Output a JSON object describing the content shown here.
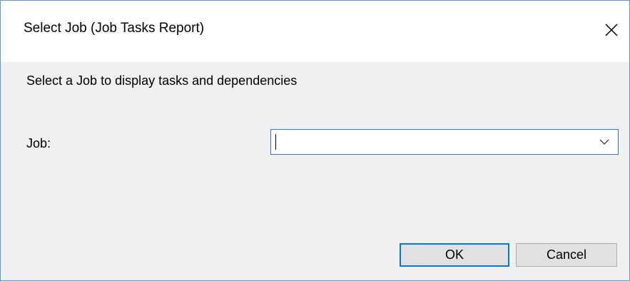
{
  "dialog": {
    "title": "Select Job (Job Tasks Report)",
    "close_icon": "close-icon",
    "instruction": "Select a Job to display tasks and dependencies",
    "job_label": "Job:",
    "job_value": "",
    "dropdown_icon": "chevron-down-icon",
    "ok_label": "OK",
    "cancel_label": "Cancel"
  },
  "colors": {
    "window_border": "#5b9bd5",
    "client_bg": "#f0f0f0",
    "focus_border": "#0078d7",
    "button_bg": "#e1e1e1"
  }
}
